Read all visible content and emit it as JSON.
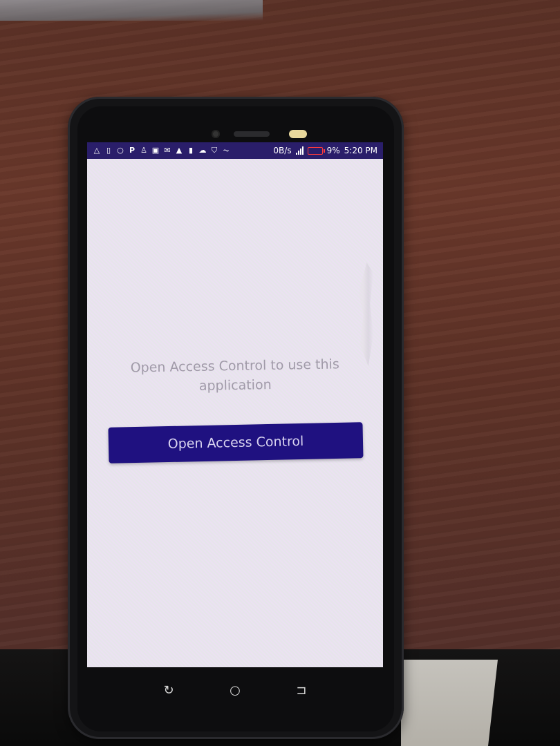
{
  "status_bar": {
    "data_rate": "0B/s",
    "battery_percent": "9%",
    "time": "5:20 PM"
  },
  "app": {
    "message": "Open Access Control to use this application",
    "open_button_label": "Open Access Control"
  },
  "nav": {
    "back_icon": "back-icon",
    "home_icon": "home-icon",
    "recents_icon": "recents-icon"
  },
  "colors": {
    "status_bar": "#2a1e6a",
    "button": "#1f1180",
    "screen_bg": "#ece7f2"
  }
}
